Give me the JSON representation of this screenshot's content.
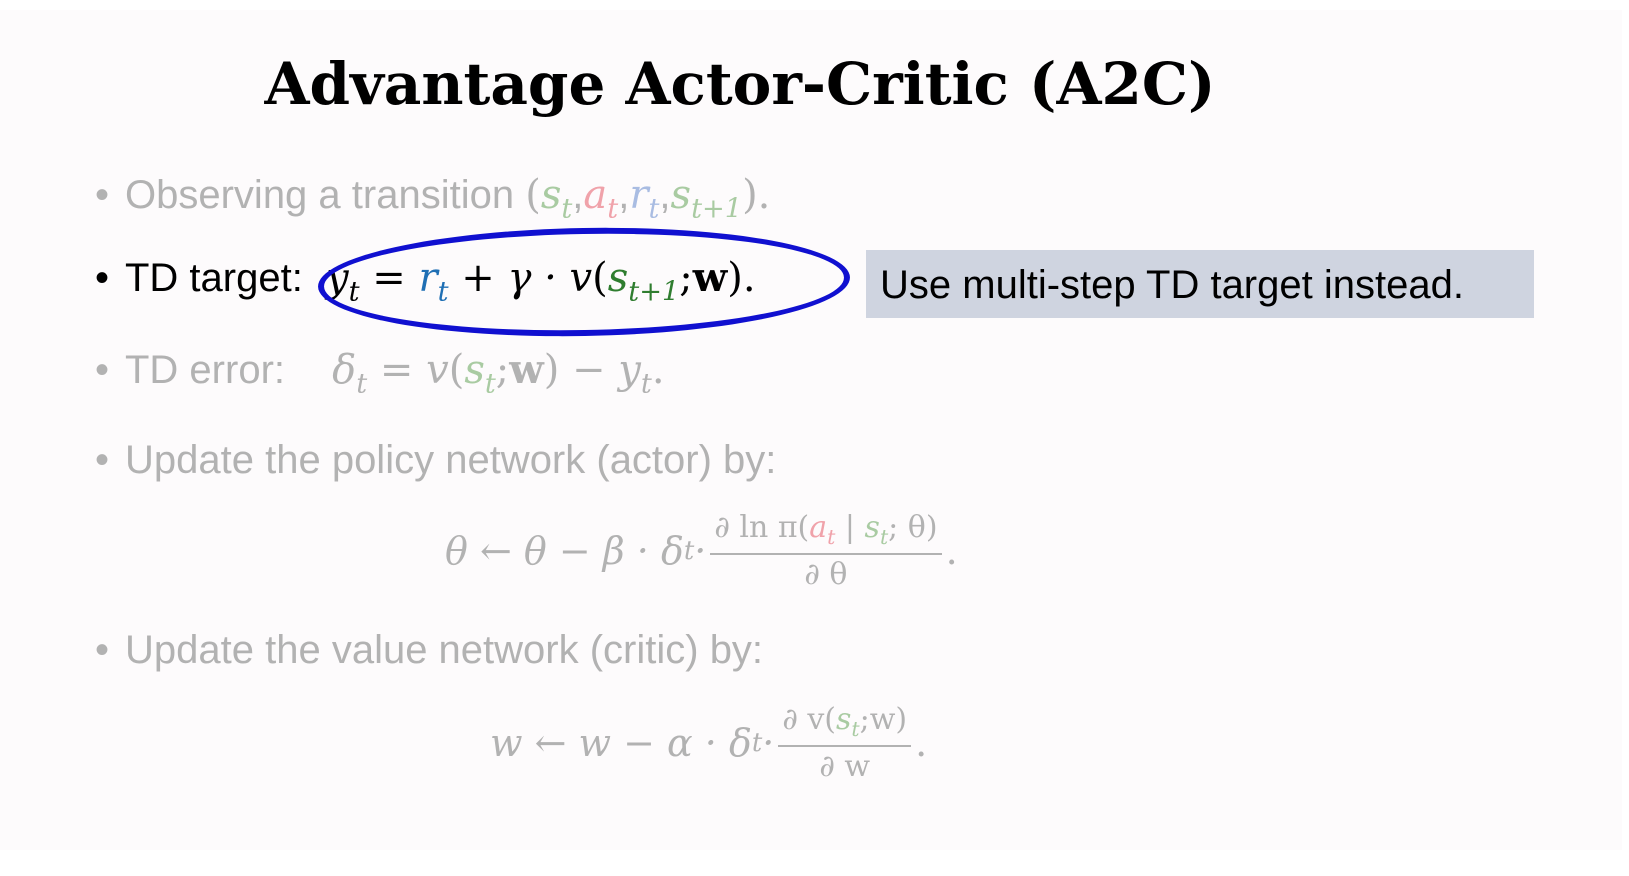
{
  "title": "Advantage Actor-Critic (A2C)",
  "bullets": {
    "observe": {
      "label": "Observing a transition",
      "open": "(",
      "s": "s",
      "t": "t",
      "a": "a",
      "r": "r",
      "next": "t+1",
      "close": ").",
      "comma": ","
    },
    "td_target": {
      "label": "TD target:",
      "y": "y",
      "t": "t",
      "eq": " = ",
      "r": "r",
      "plus": " + γ · ",
      "v": "v",
      "open": "(",
      "s": "s",
      "next": "t+1",
      "semi": ";",
      "w": "w",
      "close": ")."
    },
    "td_error": {
      "label": "TD error:",
      "delta": "δ",
      "t": "t",
      "eq": " = ",
      "v": "v",
      "open": "(",
      "s": "s",
      "semi": ";",
      "w": "w",
      "close": ") − ",
      "y": "y",
      "end": "."
    },
    "actor": {
      "label": "Update the policy network (actor) by:"
    },
    "critic": {
      "label": "Update the value network (critic) by:"
    }
  },
  "bullet_symbol": "•",
  "callout": "Use multi-step TD target instead.",
  "actor_formula": {
    "lhs": "θ ← θ − β · δ",
    "t": "t",
    "dot": " · ",
    "num_pre": "∂ ln π(",
    "a": "a",
    "bar": " | ",
    "s": "s",
    "num_post": "; θ)",
    "den": "∂ θ",
    "end": "."
  },
  "critic_formula": {
    "lhs": "w ← w − α · δ",
    "t": "t",
    "dot": " · ",
    "num_pre": "∂ v(",
    "s": "s",
    "num_post": ";w)",
    "den": "∂ w",
    "end": "."
  },
  "colors": {
    "ellipse": "#1010d0",
    "callout_bg": "#cfd4e0",
    "reward": "#1f6fb4",
    "state": "#2f7d2f"
  }
}
